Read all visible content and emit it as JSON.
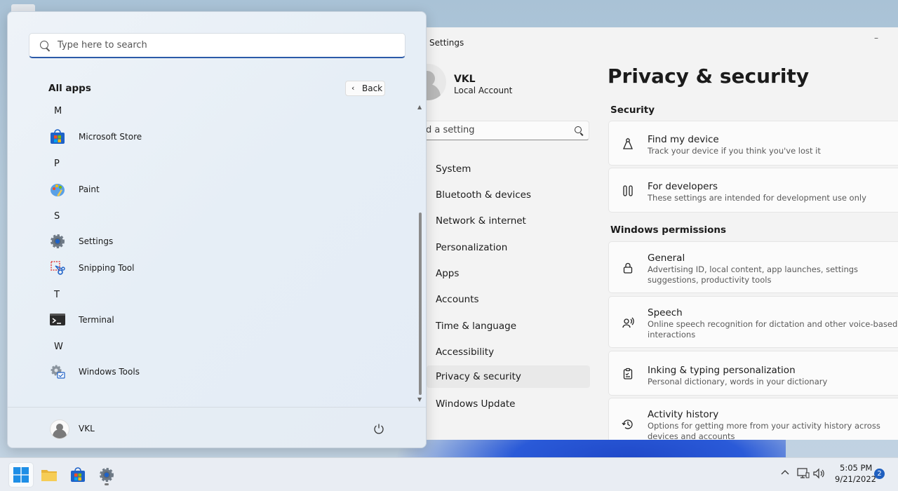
{
  "settings": {
    "title": "Settings",
    "minimize": "–",
    "user": {
      "name": "VKL",
      "account": "Local Account"
    },
    "search_placeholder": "d a setting",
    "nav": [
      "System",
      "Bluetooth & devices",
      "Network & internet",
      "Personalization",
      "Apps",
      "Accounts",
      "Time & language",
      "Accessibility",
      "Privacy & security",
      "Windows Update"
    ],
    "active_nav": "Privacy & security",
    "page_title": "Privacy & security",
    "sections": {
      "security": "Security",
      "permissions": "Windows permissions"
    },
    "cards": [
      {
        "icon": "find-device-icon",
        "title": "Find my device",
        "subtitle": "Track your device if you think you've lost it"
      },
      {
        "icon": "developer-tools-icon",
        "title": "For developers",
        "subtitle": "These settings are intended for development use only"
      },
      {
        "icon": "lock-icon",
        "title": "General",
        "subtitle": "Advertising ID, local content, app launches, settings suggestions, productivity tools"
      },
      {
        "icon": "speech-icon",
        "title": "Speech",
        "subtitle": "Online speech recognition for dictation and other voice-based interactions"
      },
      {
        "icon": "clipboard-icon",
        "title": "Inking & typing personalization",
        "subtitle": "Personal dictionary, words in your dictionary"
      },
      {
        "icon": "history-icon",
        "title": "Activity history",
        "subtitle": "Options for getting more from your activity history across devices and accounts"
      }
    ]
  },
  "start": {
    "search_placeholder": "Type here to search",
    "all_apps": "All apps",
    "back": "Back",
    "letters": {
      "m": "M",
      "p": "P",
      "s": "S",
      "t": "T",
      "w": "W"
    },
    "apps": {
      "store": "Microsoft Store",
      "paint": "Paint",
      "settings": "Settings",
      "snipping": "Snipping Tool",
      "terminal": "Terminal",
      "tools": "Windows Tools"
    },
    "user": "VKL"
  },
  "taskbar": {
    "time": "5:05 PM",
    "date": "9/21/2022",
    "notifications": "2"
  },
  "colors": {
    "accent": "#2b5aa8",
    "taskbar": "#e9edf3"
  }
}
